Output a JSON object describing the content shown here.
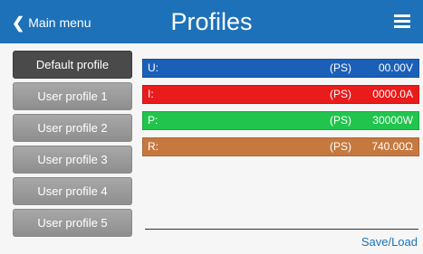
{
  "header": {
    "back_label": "Main menu",
    "title": "Profiles",
    "colors": {
      "background": "#1d71b8",
      "text": "#ffffff"
    },
    "menu_icon": "hamburger-menu-icon"
  },
  "sidebar": {
    "items": [
      {
        "label": "Default profile",
        "active": true
      },
      {
        "label": "User profile 1",
        "active": false
      },
      {
        "label": "User profile 2",
        "active": false
      },
      {
        "label": "User profile 3",
        "active": false
      },
      {
        "label": "User profile 4",
        "active": false
      },
      {
        "label": "User profile 5",
        "active": false
      }
    ]
  },
  "values": [
    {
      "label": "U:",
      "ps": "(PS)",
      "value": "00.00V",
      "color": "#1a60b8"
    },
    {
      "label": "I:",
      "ps": "(PS)",
      "value": "0000.0A",
      "color": "#ea1b1b"
    },
    {
      "label": "P:",
      "ps": "(PS)",
      "value": "30000W",
      "color": "#21c44d"
    },
    {
      "label": "R:",
      "ps": "(PS)",
      "value": "740.00Ω",
      "color": "#c6793f"
    }
  ],
  "footer": {
    "save_load_label": "Save/Load",
    "link_color": "#1d71b8"
  }
}
